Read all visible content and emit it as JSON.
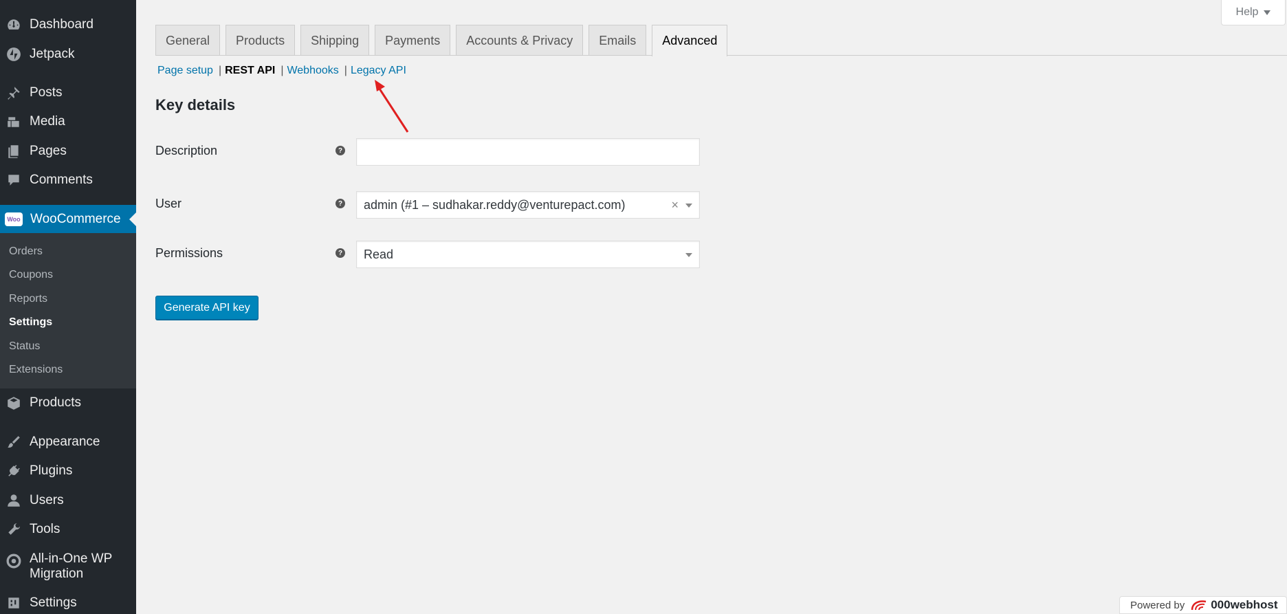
{
  "sidebar": {
    "items": [
      {
        "label": "Dashboard",
        "icon": "dashboard-icon"
      },
      {
        "label": "Jetpack",
        "icon": "jetpack-icon"
      },
      {
        "label": "Posts",
        "icon": "pin-icon"
      },
      {
        "label": "Media",
        "icon": "media-icon"
      },
      {
        "label": "Pages",
        "icon": "pages-icon"
      },
      {
        "label": "Comments",
        "icon": "comment-icon"
      },
      {
        "label": "WooCommerce",
        "icon": "woocommerce-icon",
        "badge": "Woo"
      },
      {
        "label": "Products",
        "icon": "box-icon"
      },
      {
        "label": "Appearance",
        "icon": "brush-icon"
      },
      {
        "label": "Plugins",
        "icon": "plug-icon"
      },
      {
        "label": "Users",
        "icon": "user-icon"
      },
      {
        "label": "Tools",
        "icon": "wrench-icon"
      },
      {
        "label": "All-in-One WP Migration",
        "icon": "migration-icon"
      },
      {
        "label": "Settings",
        "icon": "settings-icon"
      }
    ],
    "submenu": [
      "Orders",
      "Coupons",
      "Reports",
      "Settings",
      "Status",
      "Extensions"
    ],
    "submenu_current": "Settings"
  },
  "help": {
    "label": "Help"
  },
  "tabs": [
    "General",
    "Products",
    "Shipping",
    "Payments",
    "Accounts & Privacy",
    "Emails",
    "Advanced"
  ],
  "active_tab": "Advanced",
  "subnav": {
    "page_setup": "Page setup",
    "rest_api": "REST API",
    "webhooks": "Webhooks",
    "legacy_api": "Legacy API",
    "separator": "|"
  },
  "form": {
    "heading": "Key details",
    "description_label": "Description",
    "description_value": "",
    "user_label": "User",
    "user_value": "admin (#1 – sudhakar.reddy@venturepact.com)",
    "user_clear": "×",
    "permissions_label": "Permissions",
    "permissions_value": "Read",
    "help_glyph": "?",
    "generate_button": "Generate API key"
  },
  "footer": {
    "powered_by": "Powered by",
    "brand": "000webhost"
  },
  "colors": {
    "accent": "#0073aa",
    "sidebar_bg": "#23282d",
    "annotation_arrow": "#e02020"
  }
}
